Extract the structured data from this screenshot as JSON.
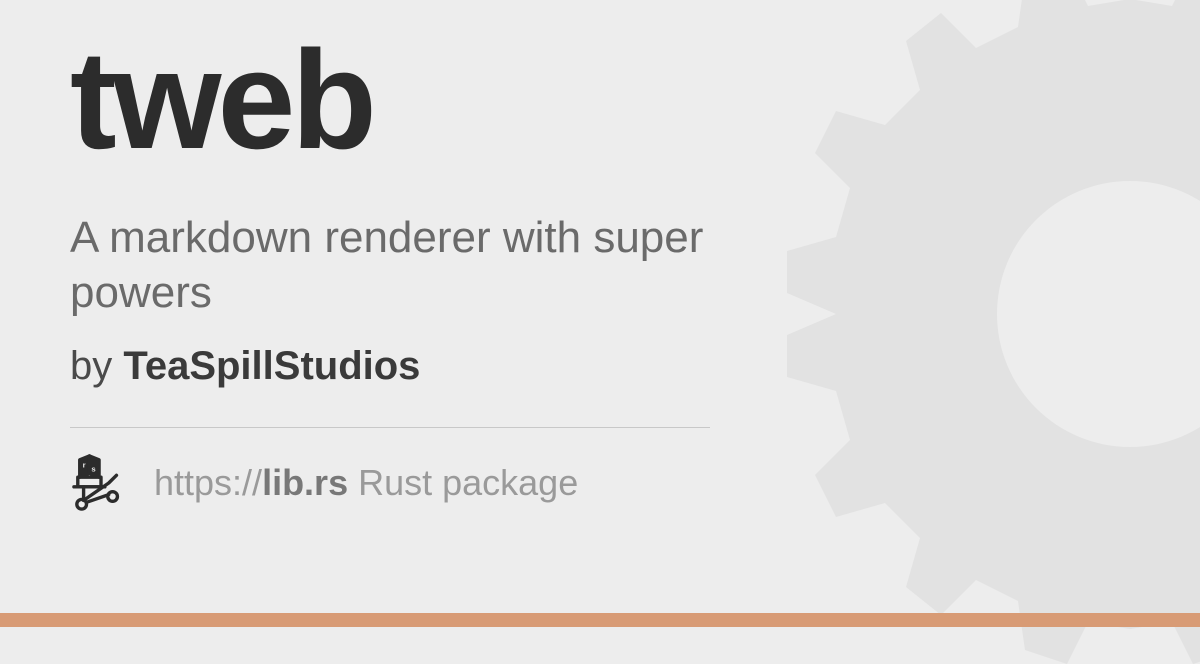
{
  "package": {
    "name": "tweb",
    "description": "A markdown renderer with super powers",
    "by_label": "by ",
    "author": "TeaSpillStudios"
  },
  "footer": {
    "url_prefix": "https://",
    "url_domain": "lib.rs",
    "url_suffix": " Rust package"
  },
  "colors": {
    "accent_bar": "#d89b75",
    "gear": "#e2e2e2"
  }
}
